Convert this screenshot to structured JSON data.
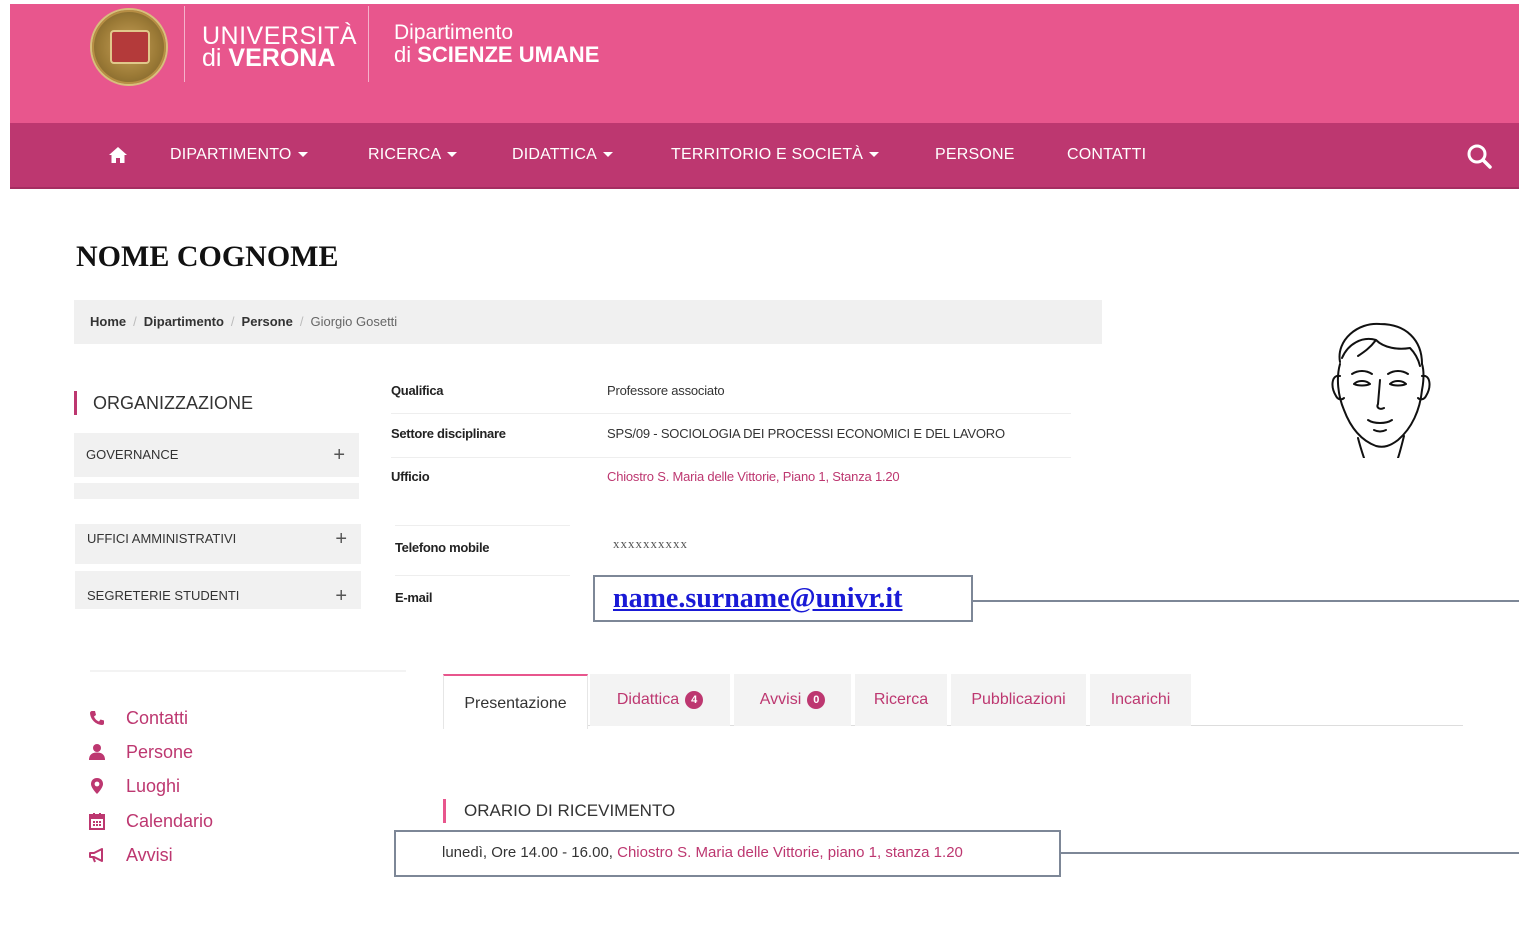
{
  "header": {
    "university_line1": "UNIVERSITÀ",
    "university_line2_prefix": "di",
    "university_line2_bold": "VERONA",
    "department_line1": "Dipartimento",
    "department_line2_prefix": "di",
    "department_line2_bold": "SCIENZE UMANE"
  },
  "nav": {
    "home_icon": "home-icon",
    "items": [
      {
        "label": "DIPARTIMENTO",
        "has_dropdown": true
      },
      {
        "label": "RICERCA",
        "has_dropdown": true
      },
      {
        "label": "DIDATTICA",
        "has_dropdown": true
      },
      {
        "label": "TERRITORIO E SOCIETÀ",
        "has_dropdown": true
      },
      {
        "label": "PERSONE",
        "has_dropdown": false
      },
      {
        "label": "CONTATTI",
        "has_dropdown": false
      }
    ],
    "search_icon": "search-icon"
  },
  "page_title": "NOME COGNOME",
  "breadcrumb": {
    "items": [
      "Home",
      "Dipartimento",
      "Persone"
    ],
    "current": "Giorgio Gosetti"
  },
  "sidebar": {
    "heading": "ORGANIZZAZIONE",
    "sections": [
      {
        "label": "GOVERNANCE"
      },
      {
        "label": "UFFICI AMMINISTRATIVI"
      },
      {
        "label": "SEGRETERIE STUDENTI"
      }
    ],
    "quicklinks": [
      {
        "label": "Contatti",
        "icon": "phone-icon"
      },
      {
        "label": "Persone",
        "icon": "person-icon"
      },
      {
        "label": "Luoghi",
        "icon": "map-marker-icon"
      },
      {
        "label": "Calendario",
        "icon": "calendar-icon"
      },
      {
        "label": "Avvisi",
        "icon": "megaphone-icon"
      }
    ]
  },
  "profile": {
    "qualifica_label": "Qualifica",
    "qualifica_value": "Professore associato",
    "settore_label": "Settore disciplinare",
    "settore_value": "SPS/09 - SOCIOLOGIA DEI PROCESSI ECONOMICI E DEL LAVORO",
    "ufficio_label": "Ufficio",
    "ufficio_value": "Chiostro S. Maria delle Vittorie, Piano 1, Stanza 1.20",
    "telefono_label": "Telefono mobile",
    "telefono_value": "xxxxxxxxxx",
    "email_label": "E-mail",
    "email_value": "name.surname@univr.it"
  },
  "tabs": [
    {
      "label": "Presentazione",
      "active": true
    },
    {
      "label": "Didattica",
      "badge": "4"
    },
    {
      "label": "Avvisi",
      "badge": "0"
    },
    {
      "label": "Ricerca"
    },
    {
      "label": "Pubblicazioni"
    },
    {
      "label": "Incarichi"
    }
  ],
  "office_hours": {
    "heading": "ORARIO DI RICEVIMENTO",
    "time": "lunedì, Ore 14.00 - 16.00,",
    "place": "Chiostro S. Maria delle Vittorie, piano 1, stanza 1.20"
  },
  "colors": {
    "header_pink": "#e8568d",
    "nav_magenta": "#bd3770",
    "link_magenta": "#bd3770",
    "annotation_gray": "#7d8797",
    "email_blue": "#1a1ad6"
  }
}
